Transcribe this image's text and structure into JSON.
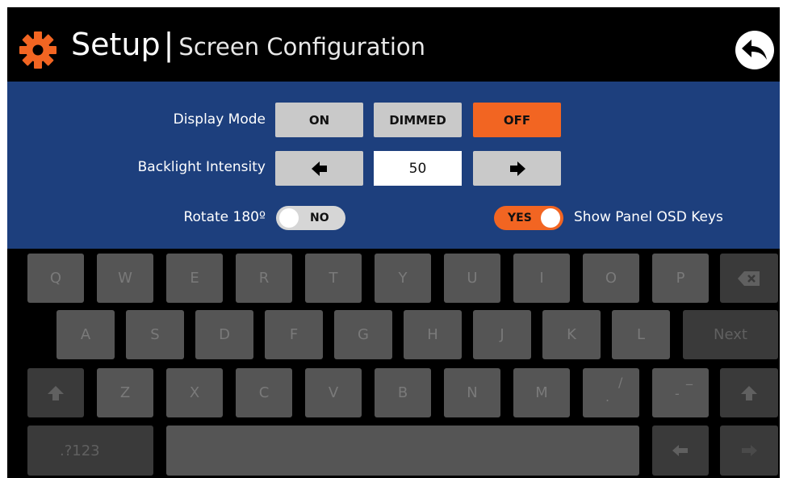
{
  "header": {
    "title": "Setup",
    "separator": "|",
    "subtitle": "Screen Configuration"
  },
  "colors": {
    "accent": "#f26522",
    "panel": "#1d3f7d",
    "button": "#c9c9c9",
    "key": "#555555",
    "key_dark": "#3a3a3a"
  },
  "settings": {
    "display_mode": {
      "label": "Display Mode",
      "options": [
        "ON",
        "DIMMED",
        "OFF"
      ],
      "selected": "OFF"
    },
    "backlight": {
      "label": "Backlight Intensity",
      "value": "50"
    },
    "rotate": {
      "label": "Rotate 180º",
      "state": "NO"
    },
    "osd_keys": {
      "label": "Show Panel OSD Keys",
      "state": "YES"
    }
  },
  "keyboard": {
    "row1": [
      "Q",
      "W",
      "E",
      "R",
      "T",
      "Y",
      "U",
      "I",
      "O",
      "P"
    ],
    "row2": [
      "A",
      "S",
      "D",
      "F",
      "G",
      "H",
      "J",
      "K",
      "L"
    ],
    "row3": [
      "Z",
      "X",
      "C",
      "V",
      "B",
      "N",
      "M"
    ],
    "next_label": "Next",
    "mode_label": ".?123",
    "slash_key": {
      "top": "/",
      "bottom": "."
    },
    "dash_key": {
      "top": "_",
      "bottom": "-"
    },
    "icons": {
      "backspace": "backspace-icon",
      "shift": "shift-icon",
      "left": "left-arrow-icon",
      "right": "right-arrow-icon"
    }
  }
}
